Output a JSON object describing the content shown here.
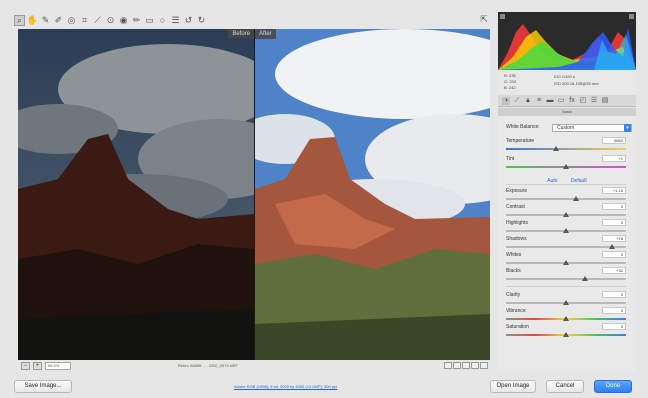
{
  "preview": {
    "before_label": "Before",
    "after_label": "After"
  },
  "statusbar": {
    "zoom_value": "56.5%",
    "file_name": "Rehm 3A806 . . . DSC_0974.NEF"
  },
  "histogram": {
    "colors": [
      "#ff2e2e",
      "#ffd400",
      "#2ee04a",
      "#2b5cff",
      "#1ed0ff",
      "#ffffff"
    ]
  },
  "readout": {
    "r": "R: 236",
    "g": "G: 233",
    "b": "B: 242",
    "line1": "f/10   1/320 s",
    "line2": "ISO 200    18-105@35 mm"
  },
  "panel": {
    "title": "Basic",
    "white_balance_label": "White Balance:",
    "white_balance_value": "Custom",
    "sliders": [
      {
        "key": "temperature",
        "label": "Temperature",
        "value": "5650",
        "pos": 0.42
      },
      {
        "key": "tint",
        "label": "Tint",
        "value": "+1",
        "pos": 0.5
      },
      {
        "key": "exposure",
        "label": "Exposure",
        "value": "+1.15",
        "pos": 0.58
      },
      {
        "key": "contrast",
        "label": "Contrast",
        "value": "0",
        "pos": 0.5
      },
      {
        "key": "highlights",
        "label": "Highlights",
        "value": "0",
        "pos": 0.5
      },
      {
        "key": "shadows",
        "label": "Shadows",
        "value": "+76",
        "pos": 0.88
      },
      {
        "key": "whites",
        "label": "Whites",
        "value": "0",
        "pos": 0.5
      },
      {
        "key": "blacks",
        "label": "Blacks",
        "value": "+32",
        "pos": 0.66
      },
      {
        "key": "clarity",
        "label": "Clarity",
        "value": "0",
        "pos": 0.5
      },
      {
        "key": "vibrance",
        "label": "Vibrance",
        "value": "0",
        "pos": 0.5
      },
      {
        "key": "saturation",
        "label": "Saturation",
        "value": "0",
        "pos": 0.5
      }
    ],
    "auto_label": "Auto",
    "default_label": "Default"
  },
  "bottom": {
    "save_label": "Save Image...",
    "workflow_label": "Adobe RGB (1998); 8 bit; 3000 by 4000 (12.0MP); 300 ppi",
    "open_label": "Open Image",
    "cancel_label": "Cancel",
    "done_label": "Done"
  }
}
